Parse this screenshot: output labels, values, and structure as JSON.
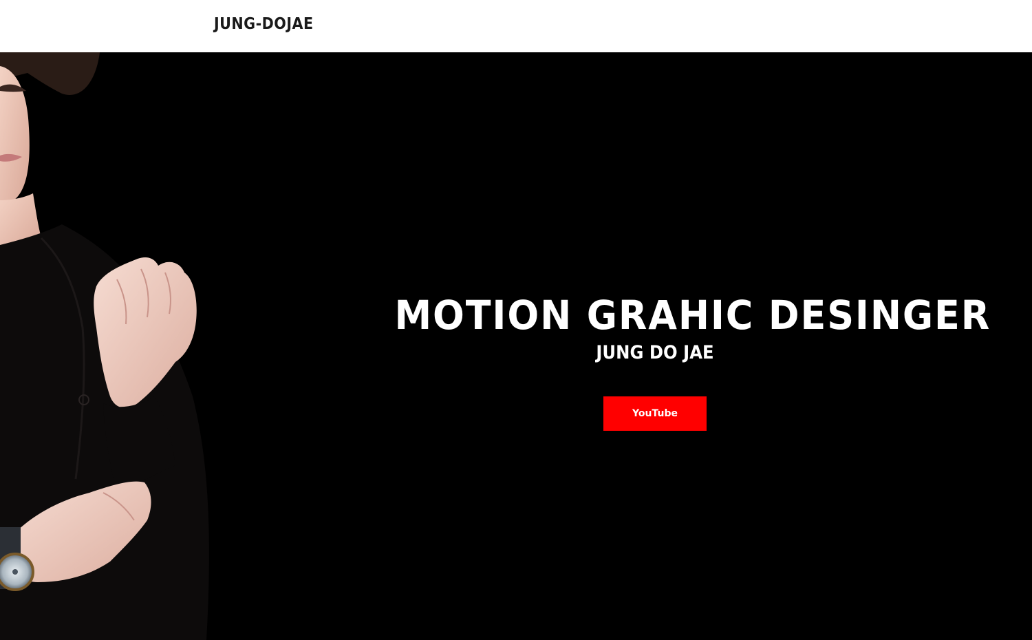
{
  "header": {
    "brand": "JUNG-DOJAE"
  },
  "hero": {
    "headline": "MOTION GRAHIC DESINGER",
    "name": "JUNG DO JAE",
    "button_label": "YouTube",
    "button_color": "#ff0000",
    "background_color": "#000000",
    "image": "portrait-photo"
  }
}
